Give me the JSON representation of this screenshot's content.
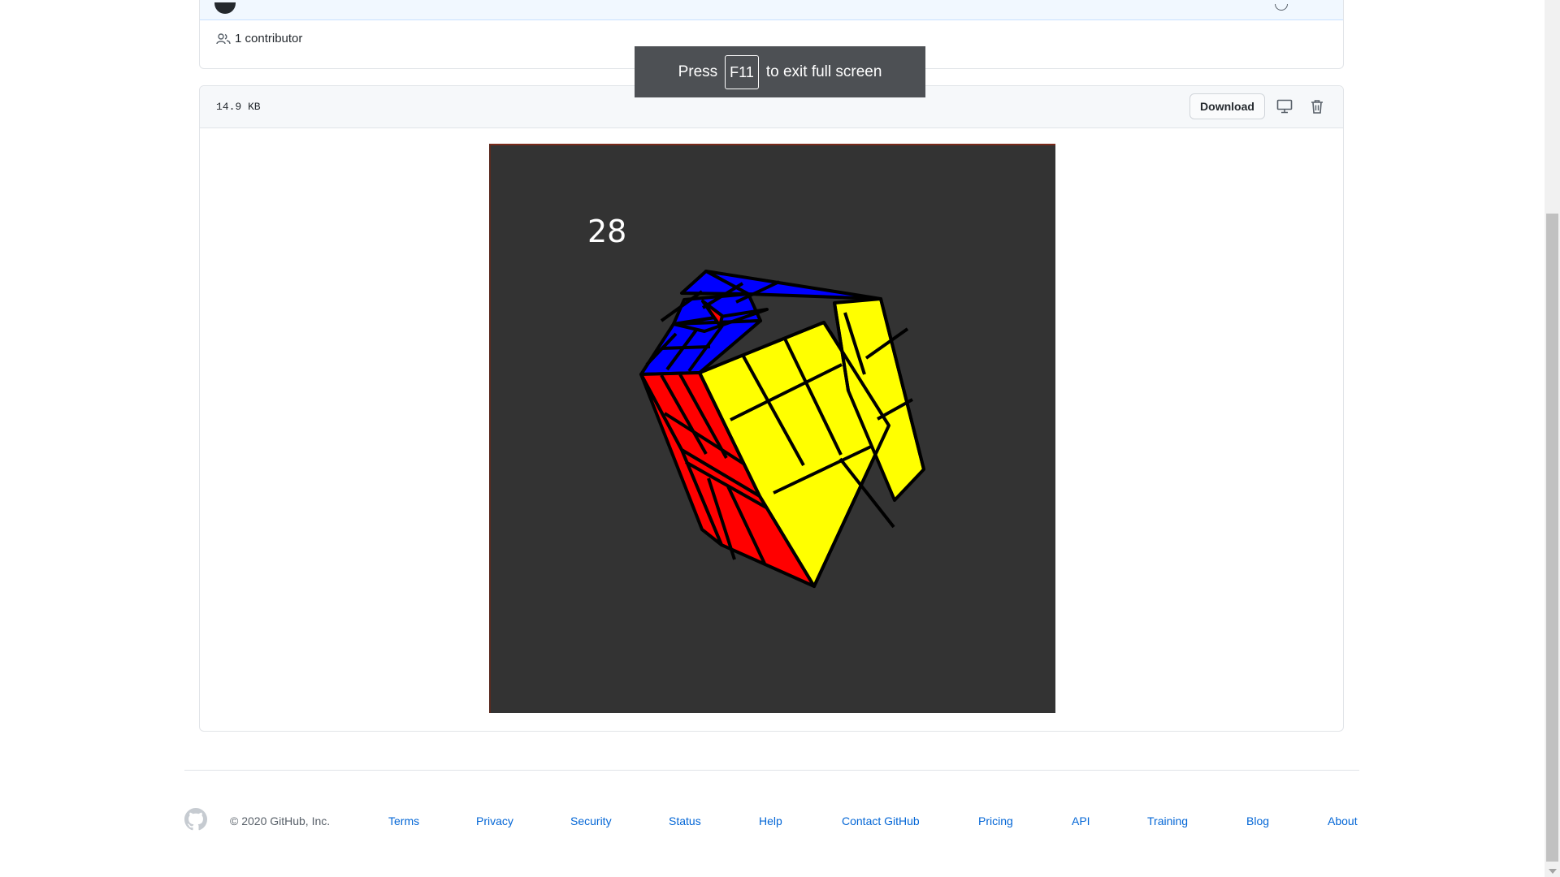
{
  "commit": {
    "contributors_label": "1 contributor"
  },
  "file": {
    "size": "14.9 KB",
    "download_label": "Download",
    "preview": {
      "move_count": "28"
    }
  },
  "icons": {
    "contributors": "people-icon",
    "desktop": "desktop-icon",
    "trash": "trash-icon",
    "github": "github-logo-icon",
    "history": "history-icon"
  },
  "fullscreen_notice": {
    "before": "Press",
    "key": "F11",
    "after": "to exit full screen"
  },
  "footer": {
    "copyright": "© 2020 GitHub, Inc.",
    "links": [
      "Terms",
      "Privacy",
      "Security",
      "Status",
      "Help",
      "Contact GitHub",
      "Pricing",
      "API",
      "Training",
      "Blog",
      "About"
    ]
  },
  "colors": {
    "link": "#0366d6",
    "cube_yellow": "#ffff00",
    "cube_red": "#ff0000",
    "cube_blue": "#0000ff",
    "preview_background": "#333333"
  }
}
